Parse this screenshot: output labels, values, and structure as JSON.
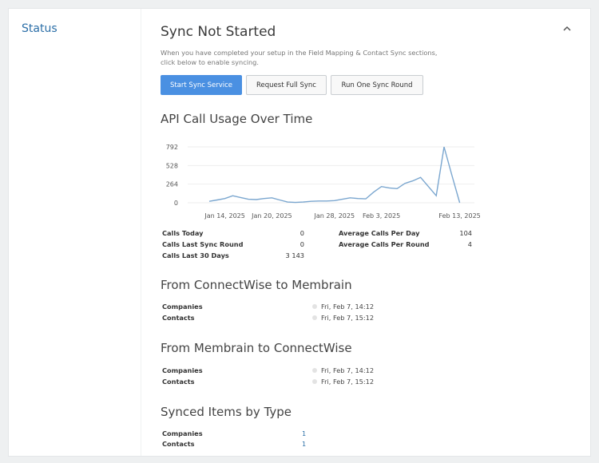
{
  "sidebar": {
    "title": "Status"
  },
  "main": {
    "title": "Sync Not Started",
    "description": "When you have completed your setup in the Field Mapping & Contact Sync sections, click below to enable syncing.",
    "buttons": [
      "Start Sync Service",
      "Request Full Sync",
      "Run One Sync Round"
    ]
  },
  "api_usage": {
    "title": "API Call Usage Over Time",
    "chart_data": {
      "type": "line",
      "x": [
        "Jan 12",
        "Jan 13",
        "Jan 14",
        "Jan 15",
        "Jan 16",
        "Jan 17",
        "Jan 18",
        "Jan 19",
        "Jan 20",
        "Jan 21",
        "Jan 22",
        "Jan 23",
        "Jan 24",
        "Jan 25",
        "Jan 26",
        "Jan 27",
        "Jan 28",
        "Jan 29",
        "Jan 30",
        "Jan 31",
        "Feb 1",
        "Feb 2",
        "Feb 3",
        "Feb 4",
        "Feb 5",
        "Feb 6",
        "Feb 7",
        "Feb 8",
        "Feb 9",
        "Feb 10",
        "Feb 11",
        "Feb 12",
        "Feb 13"
      ],
      "values": [
        20,
        40,
        60,
        100,
        75,
        50,
        45,
        60,
        70,
        40,
        10,
        5,
        10,
        20,
        25,
        25,
        30,
        50,
        70,
        60,
        55,
        150,
        230,
        210,
        200,
        275,
        310,
        360,
        230,
        100,
        792,
        390,
        0
      ],
      "xtick_labels": [
        "Jan 14, 2025",
        "Jan 20, 2025",
        "Jan 28, 2025",
        "Feb 3, 2025",
        "Feb 13, 2025"
      ],
      "ytick_labels": [
        "792",
        "528",
        "264",
        "0"
      ],
      "ylim": [
        0,
        792
      ],
      "grid": true,
      "colors": {
        "line": "#7aa6cf",
        "grid": "#eeeeee"
      }
    }
  },
  "stats": {
    "left": [
      {
        "label": "Calls Today",
        "value": "0"
      },
      {
        "label": "Calls Last Sync Round",
        "value": "0"
      },
      {
        "label": "Calls Last 30 Days",
        "value": "3 143"
      }
    ],
    "right": [
      {
        "label": "Average Calls Per Day",
        "value": "104"
      },
      {
        "label": "Average Calls Per Round",
        "value": "4"
      }
    ]
  },
  "cw_to_mb": {
    "title": "From ConnectWise to Membrain",
    "rows": [
      {
        "label": "Companies",
        "value": "Fri, Feb 7, 14:12"
      },
      {
        "label": "Contacts",
        "value": "Fri, Feb 7, 15:12"
      }
    ]
  },
  "mb_to_cw": {
    "title": "From Membrain to ConnectWise",
    "rows": [
      {
        "label": "Companies",
        "value": "Fri, Feb 7, 14:12"
      },
      {
        "label": "Contacts",
        "value": "Fri, Feb 7, 15:12"
      }
    ]
  },
  "synced": {
    "title": "Synced Items by Type",
    "rows": [
      {
        "label": "Companies",
        "value": "1"
      },
      {
        "label": "Contacts",
        "value": "1"
      }
    ]
  },
  "icons": {
    "collapse": "chevron-up-icon"
  }
}
